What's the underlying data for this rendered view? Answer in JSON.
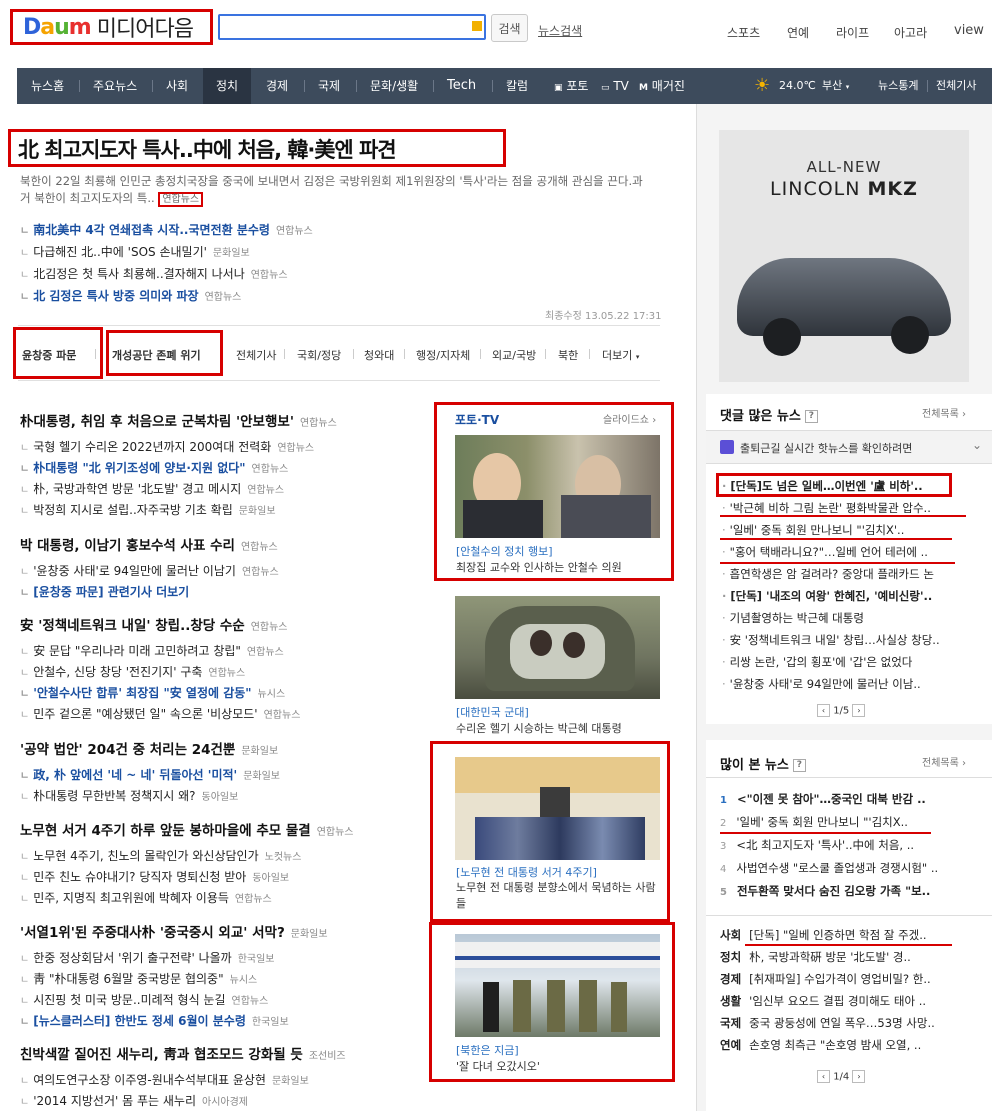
{
  "header": {
    "logo_daum": [
      "D",
      "a",
      "u",
      "m"
    ],
    "logo_text": "미디어다음",
    "search_button": "검색",
    "news_search": "뉴스검색",
    "top_links": [
      "스포츠",
      "연예",
      "라이프",
      "아고라",
      "view"
    ]
  },
  "gnb": {
    "items": [
      "뉴스홈",
      "주요뉴스",
      "사회",
      "정치",
      "경제",
      "국제",
      "문화/생활",
      "Tech",
      "칼럼",
      "포토",
      "TV",
      "매거진"
    ],
    "active": "정치",
    "weather_temp": "24.0℃",
    "weather_city": "부산",
    "right_links": [
      "뉴스통계",
      "전체기사"
    ]
  },
  "headline": {
    "title": "北 최고지도자 특사..中에 처음, 韓·美엔 파견",
    "desc": "북한이 22일 최룡해 인민군 총정치국장을 중국에 보내면서 김정은 국방위원회 제1위원장의 '특사'라는 점을 공개해 관심을 끈다.과거 북한이 최고지도자의 특..",
    "desc_source": "연합뉴스",
    "subs": [
      {
        "text": "南北美中 4각 연쇄접촉 시작..국면전환 분수령",
        "src": "연합뉴스",
        "blue": true
      },
      {
        "text": "다급해진 北..中에 'SOS 손내밀기'",
        "src": "문화일보",
        "blue": false
      },
      {
        "text": "北김정은 첫 특사 최룡해..결자해지 나서나",
        "src": "연합뉴스",
        "blue": false
      },
      {
        "text": "北 김정은 특사 방중 의미와 파장",
        "src": "연합뉴스",
        "blue": true
      }
    ],
    "updated": "최종수정 13.05.22 17:31"
  },
  "tabs": {
    "boxed": [
      "윤창중 파문",
      "개성공단 존폐 위기"
    ],
    "plain": [
      "전체기사",
      "국회/정당",
      "청와대",
      "행정/지자체",
      "외교/국방",
      "북한",
      "더보기"
    ]
  },
  "news": [
    {
      "title": "朴대통령, 취임 후 처음으로 군복차림 '안보행보'",
      "src": "연합뉴스",
      "subs": [
        {
          "text": "국형 헬기 수리온 2022년까지 200여대 전력화",
          "src": "연합뉴스",
          "blue": false
        },
        {
          "text": "朴대통령 \"北 위기조성에 양보·지원 없다\"",
          "src": "연합뉴스",
          "blue": true
        },
        {
          "text": "朴, 국방과학연 방문 '北도발' 경고 메시지",
          "src": "연합뉴스",
          "blue": false
        },
        {
          "text": "박정희 지시로 설립..자주국방 기초 확립",
          "src": "문화일보",
          "blue": false
        }
      ]
    },
    {
      "title": "박 대통령, 이남기 홍보수석 사표 수리",
      "src": "연합뉴스",
      "subs": [
        {
          "text": "'윤창중 사태'로 94일만에 물러난 이남기",
          "src": "연합뉴스",
          "blue": false
        },
        {
          "text": "[윤창중 파문] 관련기사 더보기",
          "src": "",
          "blue": true
        }
      ]
    },
    {
      "title": "安 '정책네트워크 내일' 창립..창당 수순",
      "src": "연합뉴스",
      "subs": [
        {
          "text": "安 문답 \"우리나라 미래 고민하려고 창립\"",
          "src": "연합뉴스",
          "blue": false
        },
        {
          "text": "안철수, 신당 창당 '전진기지' 구축",
          "src": "연합뉴스",
          "blue": false
        },
        {
          "text": "'안철수사단 합류' 최장집 \"安 열정에 감동\"",
          "src": "뉴시스",
          "blue": true
        },
        {
          "text": "민주 겉으론 \"예상됐던 일\" 속으론 '비상모드'",
          "src": "연합뉴스",
          "blue": false
        }
      ]
    },
    {
      "title": "'공약 법안' 204건 중 처리는 24건뿐",
      "src": "문화일보",
      "subs": [
        {
          "text": "政, 朴 앞에선 '네 ~ 네' 뒤돌아선 '미적'",
          "src": "문화일보",
          "blue": true
        },
        {
          "text": "朴대통령 무한반복 정책지시 왜?",
          "src": "동아일보",
          "blue": false
        }
      ]
    },
    {
      "title": "노무현 서거 4주기 하루 앞둔 봉하마을에 추모 물결",
      "src": "연합뉴스",
      "subs": [
        {
          "text": "노무현 4주기, 친노의 몰락인가 와신상담인가",
          "src": "노컷뉴스",
          "blue": false
        },
        {
          "text": "민주 친노 슈야내기? 당직자 명퇴신청 받아",
          "src": "동아일보",
          "blue": false
        },
        {
          "text": "민주, 지명직 최고위원에 박혜자 이용득",
          "src": "연합뉴스",
          "blue": false
        }
      ]
    },
    {
      "title": "'서열1위'된 주중대사朴 '중국중시 외교' 서막?",
      "src": "문화일보",
      "subs": [
        {
          "text": "한중 정상회담서 '위기 출구전략' 나올까",
          "src": "한국일보",
          "blue": false
        },
        {
          "text": "靑 \"朴대통령 6월말 중국방문 협의중\"",
          "src": "뉴시스",
          "blue": false
        },
        {
          "text": "시진핑 첫 미국 방문..미례적 형식 눈길",
          "src": "연합뉴스",
          "blue": false
        },
        {
          "text": "[뉴스클러스터] 한반도 정세 6월이 분수령",
          "src": "한국일보",
          "blue": true
        }
      ]
    },
    {
      "title": "친박색깔 짙어진 새누리, 靑과 협조모드 강화될 듯",
      "src": "조선비즈",
      "subs": [
        {
          "text": "여의도연구소장 이주영-원내수석부대표 윤상현",
          "src": "문화일보",
          "blue": false
        },
        {
          "text": "'2014 지방선거' 몸 푸는 새누리",
          "src": "아시아경제",
          "blue": false
        }
      ]
    }
  ],
  "photo": {
    "header": "포토·TV",
    "slideshow": "슬라이드쇼",
    "items": [
      {
        "tag": "[안철수의 정치 행보]",
        "caption": "최장집 교수와 인사하는 안철수 의원"
      },
      {
        "tag": "[대한민국 군대]",
        "caption": "수리온 헬기 시승하는 박근혜 대통령"
      },
      {
        "tag": "[노무현 전 대통령 서거 4주기]",
        "caption": "노무현 전 대통령 분향소에서 묵념하는 사람들"
      },
      {
        "tag": "[북한은 지금]",
        "caption": "'잘 다녀 오갔시오'"
      }
    ]
  },
  "ad": {
    "line1": "ALL-NEW",
    "line2": "LINCOLN",
    "line3": "MKZ"
  },
  "comments": {
    "title": "댓글 많은 뉴스",
    "more": "전체목록",
    "banner": "출퇴근길 실시간 핫뉴스를 확인하려면",
    "items": [
      "[단독]도 넘은 일베…이번엔 '盧 비하'..",
      "'박근혜 비하 그림 논란' 평화박물관 압수..",
      "'일베' 중독 회원 만나보니 \"'김치X'..",
      "\"홍어 택배라니요?\"…일베 언어 테러에 ..",
      "흡연학생은 암 걸려라? 중앙대 플래카드 논",
      "[단독] '내조의 여왕' 한혜진, '예비신랑'..",
      "기념촬영하는 박근혜 대통령",
      "安 '정책네트워크 내일' 창립…사실상 창당..",
      "리쌍 논란, '갑의 횡포'에 '갑'은 없었다",
      "'윤창중 사태'로 94일만에 물러난 이남.."
    ],
    "page": "1/5"
  },
  "popular": {
    "title": "많이 본 뉴스",
    "more": "전체목록",
    "items": [
      {
        "n": "1",
        "text": "<\"이젠 못 참아\"…중국인 대북 반감 .."
      },
      {
        "n": "2",
        "text": "'일베' 중독 회원 만나보니 \"'김치X.."
      },
      {
        "n": "3",
        "text": "<北 최고지도자 '특사'..中에 처음, .."
      },
      {
        "n": "4",
        "text": "사법연수생 \"로스쿨 졸업생과 경쟁시험\" .."
      },
      {
        "n": "5",
        "text": "전두환쪽 맞서다 숨진 김오랑 가족 \"보.."
      }
    ],
    "sections": [
      {
        "cat": "사회",
        "text": "[단독] \"일베 인증하면 학점 잘 주겠.."
      },
      {
        "cat": "정치",
        "text": "朴, 국방과학硏 방문 '北도발' 경.."
      },
      {
        "cat": "경제",
        "text": "[취재파일] 수입가격이 영업비밀? 한.."
      },
      {
        "cat": "생활",
        "text": "'임신부 요오드 결핍 경미해도 태아 .."
      },
      {
        "cat": "국제",
        "text": "중국 광둥성에 연일 폭우…53명 사망.."
      },
      {
        "cat": "연예",
        "text": "손호영 최측근 \"손호영 밤새 오열, .."
      }
    ],
    "page": "1/4"
  }
}
